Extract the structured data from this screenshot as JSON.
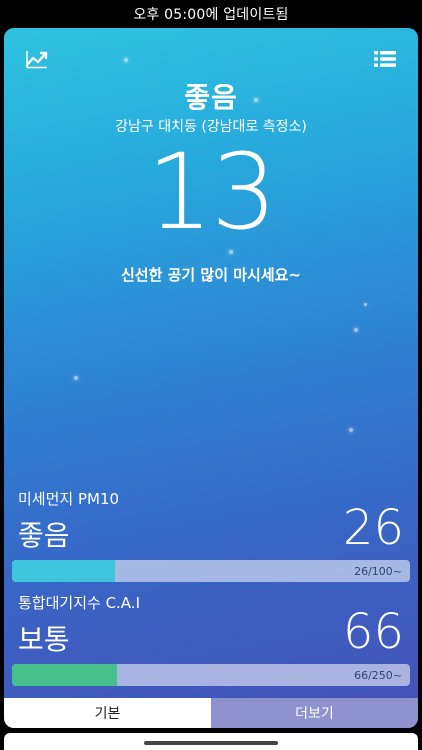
{
  "status_bar": {
    "update_text": "오후 05:00에 업데이트됨"
  },
  "header": {
    "left_icon": "chart-line-icon",
    "right_icon": "list-icon"
  },
  "main": {
    "status": "좋음",
    "location": "강남구 대치동 (강남대로 측정소)",
    "index_value": "13",
    "message": "신선한 공기 많이 마시세요~"
  },
  "metrics": [
    {
      "label": "미세먼지 PM10",
      "grade": "좋음",
      "value": "26",
      "bar_text": "26/100~",
      "fill_fraction": 0.26,
      "fill_color": "#3fc4de"
    },
    {
      "label": "통합대기지수 C.A.I",
      "grade": "보통",
      "value": "66",
      "bar_text": "66/250~",
      "fill_fraction": 0.264,
      "fill_color": "#48c08e"
    }
  ],
  "tabs": [
    {
      "label": "기본",
      "active": true
    },
    {
      "label": "더보기",
      "active": false
    }
  ],
  "colors": {
    "gradient_top": "#2fc3e0",
    "gradient_bottom": "#4750b6",
    "tab_more_bg": "#8e92cf"
  }
}
